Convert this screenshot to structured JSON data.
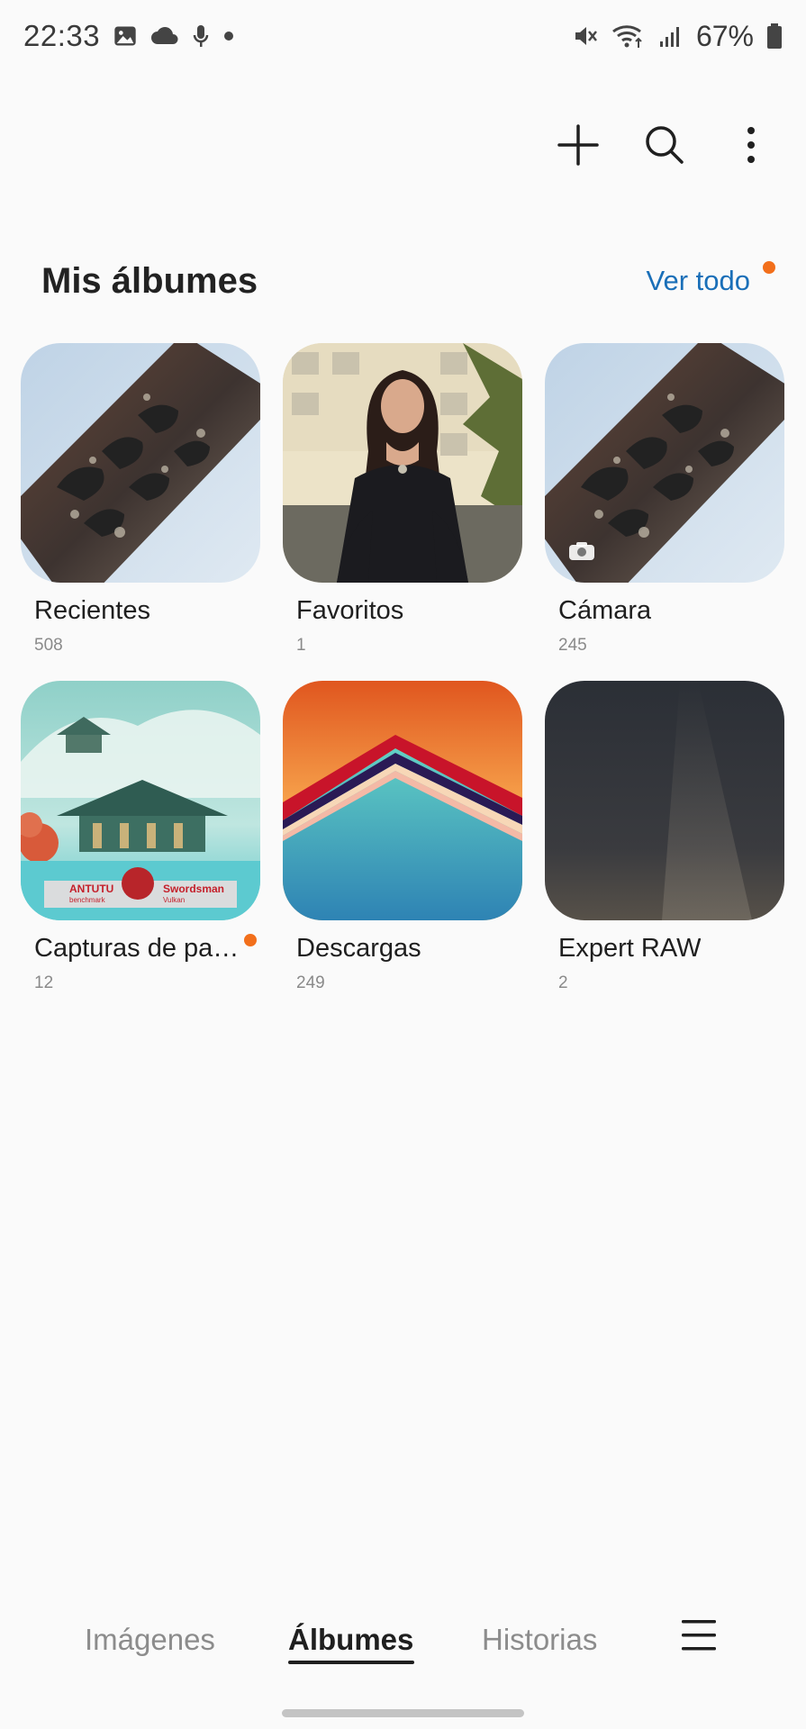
{
  "status_bar": {
    "time": "22:33",
    "battery_percent": "67%",
    "left_icons": [
      "image-icon",
      "cloud-icon",
      "mic-icon",
      "dot-icon"
    ],
    "right_icons": [
      "mute-icon",
      "wifi-icon",
      "signal-icon",
      "battery-icon"
    ]
  },
  "action_bar": {
    "icons": [
      "add-icon",
      "search-icon",
      "more-vert-icon"
    ]
  },
  "section": {
    "title": "Mis álbumes",
    "see_all": "Ver todo"
  },
  "albums": [
    {
      "name": "Recientes",
      "count": "508"
    },
    {
      "name": "Favoritos",
      "count": "1"
    },
    {
      "name": "Cámara",
      "count": "245"
    },
    {
      "name": "Capturas de pa…",
      "count": "12"
    },
    {
      "name": "Descargas",
      "count": "249"
    },
    {
      "name": "Expert RAW",
      "count": "2"
    }
  ],
  "capture_thumb_text": {
    "brand": "ANTUTU",
    "brand_sub": "benchmark",
    "game": "Swordsman",
    "game_sub": "Vulkan"
  },
  "bottom_nav": {
    "tabs": [
      "Imágenes",
      "Álbumes",
      "Historias"
    ],
    "active_tab": "Álbumes"
  },
  "colors": {
    "accent_dot": "#f26f1b",
    "link": "#1a6fb8",
    "background": "#fafafa"
  }
}
